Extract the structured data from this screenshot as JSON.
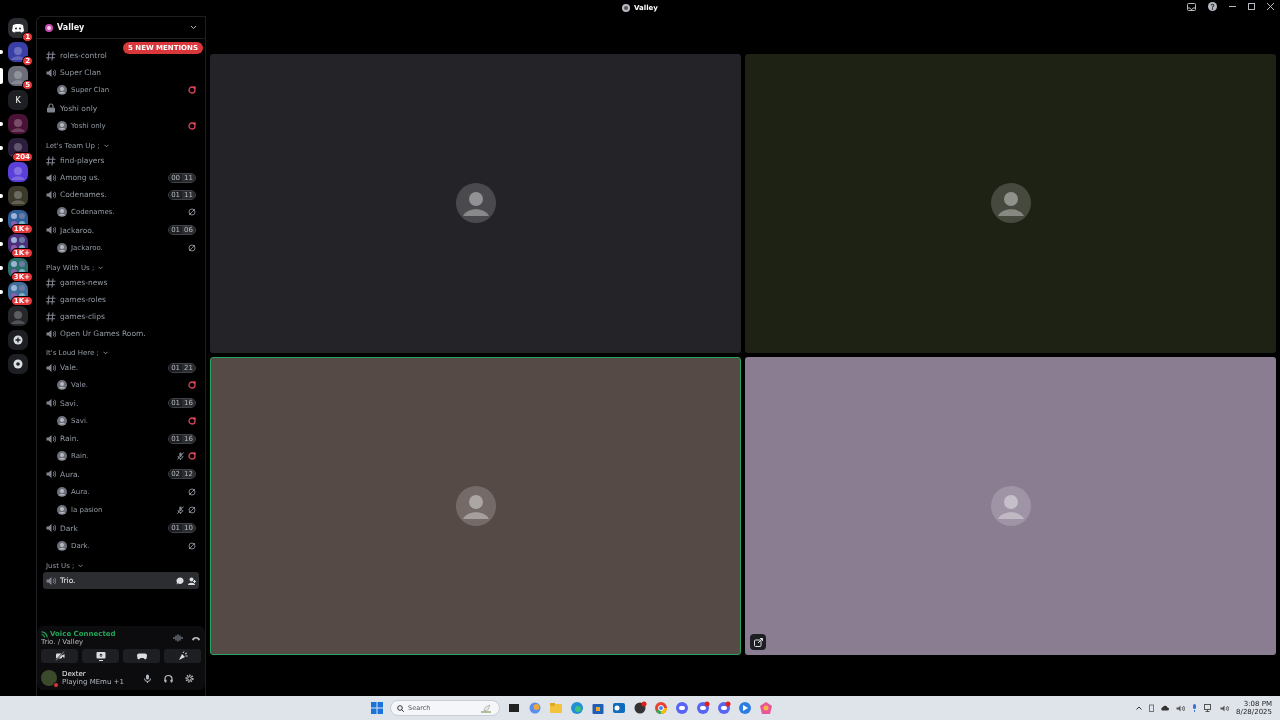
{
  "window": {
    "title": "Valley"
  },
  "servers": [
    {
      "kind": "home",
      "badge": "1",
      "unread": false,
      "selected": false,
      "color": "#2b2d31"
    },
    {
      "kind": "picture",
      "badge": "2",
      "unread": true,
      "selected": false,
      "color": "#3a3fa8"
    },
    {
      "kind": "picture",
      "badge": "5",
      "unread": false,
      "selected": true,
      "color": "#6b6e78"
    },
    {
      "kind": "letter",
      "label": "K",
      "unread": false,
      "selected": false,
      "color": "#1e1f22"
    },
    {
      "kind": "picture",
      "unread": true,
      "selected": false,
      "color": "#4a1236"
    },
    {
      "kind": "picture",
      "badge": "204",
      "unread": true,
      "selected": false,
      "color": "#2a1e3c"
    },
    {
      "kind": "picture",
      "unread": false,
      "selected": false,
      "color": "#5b3fd9"
    },
    {
      "kind": "picture",
      "unread": true,
      "selected": false,
      "color": "#3b3a2a"
    },
    {
      "kind": "folder",
      "badge": "1K+",
      "unread": true,
      "selected": false,
      "color": "#2f5f9a"
    },
    {
      "kind": "folder",
      "badge": "1K+",
      "unread": true,
      "selected": false,
      "color": "#4b2f7a"
    },
    {
      "kind": "folder",
      "badge": "3K+",
      "unread": true,
      "selected": false,
      "color": "#2a6f6a"
    },
    {
      "kind": "folder",
      "badge": "1K+",
      "unread": true,
      "selected": false,
      "color": "#3d6f9a"
    },
    {
      "kind": "picture",
      "unread": false,
      "selected": false,
      "color": "#26272b"
    },
    {
      "kind": "add",
      "unread": false,
      "selected": false,
      "color": "#1e1f22"
    },
    {
      "kind": "discover",
      "unread": false,
      "selected": false,
      "color": "#1e1f22"
    }
  ],
  "guild": {
    "name": "Valley"
  },
  "mentions_pill": "5 NEW MENTIONS",
  "channels": [
    {
      "kind": "text",
      "name": "roles-control",
      "selected": false
    },
    {
      "kind": "voice",
      "name": "Super Clan",
      "selected": false
    },
    {
      "kind": "member",
      "name": "Super Clan",
      "activity": true,
      "muted": false,
      "selected": false
    },
    {
      "kind": "locked",
      "name": "Yoshi only",
      "selected": false
    },
    {
      "kind": "member",
      "name": "Yoshi only",
      "activity": true,
      "muted": false,
      "selected": false
    },
    {
      "kind": "category",
      "name": "Let's Team Up ;",
      "selected": false
    },
    {
      "kind": "text",
      "name": "find-players",
      "selected": false
    },
    {
      "kind": "voice",
      "name": "Among us.",
      "counts": [
        "00",
        "11"
      ],
      "selected": false
    },
    {
      "kind": "voice",
      "name": "Codenames.",
      "counts": [
        "01",
        "11"
      ],
      "selected": false
    },
    {
      "kind": "member",
      "name": "Codenames.",
      "activity": false,
      "muted": false,
      "selected": false
    },
    {
      "kind": "voice",
      "name": "Jackaroo.",
      "counts": [
        "01",
        "06"
      ],
      "selected": false
    },
    {
      "kind": "member",
      "name": "Jackaroo.",
      "activity": false,
      "muted": false,
      "selected": false
    },
    {
      "kind": "category",
      "name": "Play With Us ;",
      "selected": false
    },
    {
      "kind": "text",
      "name": "games-news",
      "selected": false
    },
    {
      "kind": "text",
      "name": "games-roles",
      "selected": false
    },
    {
      "kind": "text",
      "name": "games-clips",
      "selected": false
    },
    {
      "kind": "voice",
      "name": "Open Ur Games Room.",
      "selected": false
    },
    {
      "kind": "category",
      "name": "It's Loud Here ;",
      "selected": false
    },
    {
      "kind": "voice",
      "name": "Vale.",
      "counts": [
        "01",
        "21"
      ],
      "selected": false
    },
    {
      "kind": "member",
      "name": "Vale.",
      "activity": true,
      "muted": false,
      "selected": false
    },
    {
      "kind": "voice",
      "name": "Savi.",
      "counts": [
        "01",
        "16"
      ],
      "selected": false
    },
    {
      "kind": "member",
      "name": "Savi.",
      "activity": true,
      "muted": false,
      "selected": false
    },
    {
      "kind": "voice",
      "name": "Rain.",
      "counts": [
        "01",
        "16"
      ],
      "selected": false
    },
    {
      "kind": "member",
      "name": "Rain.",
      "activity": true,
      "muted": true,
      "selected": false
    },
    {
      "kind": "voice",
      "name": "Aura.",
      "counts": [
        "02",
        "12"
      ],
      "selected": false
    },
    {
      "kind": "member",
      "name": "Aura.",
      "activity": false,
      "muted": false,
      "selected": false
    },
    {
      "kind": "member",
      "name": "la pasion",
      "activity": false,
      "muted": true,
      "selected": false
    },
    {
      "kind": "voice",
      "name": "Dark",
      "counts": [
        "01",
        "10"
      ],
      "selected": false
    },
    {
      "kind": "member",
      "name": "Dark.",
      "activity": false,
      "muted": false,
      "selected": false
    },
    {
      "kind": "category",
      "name": "Just Us ;",
      "selected": false
    },
    {
      "kind": "voice",
      "name": "Trio.",
      "selected": true
    }
  ],
  "voice_panel": {
    "status": "Voice Connected",
    "location": "Trio. / Valley"
  },
  "user": {
    "name": "Dexter",
    "activity": "Playing MEmu +1"
  },
  "tiles": [
    {
      "color": "#232328",
      "speaking": false
    },
    {
      "color": "#1e2214",
      "speaking": false
    },
    {
      "color": "#564a46",
      "speaking": true
    },
    {
      "color": "#8a7d92",
      "speaking": false,
      "popout": true
    }
  ],
  "taskbar": {
    "search": "Search",
    "time": "3:08 PM",
    "date": "8/28/2025"
  }
}
